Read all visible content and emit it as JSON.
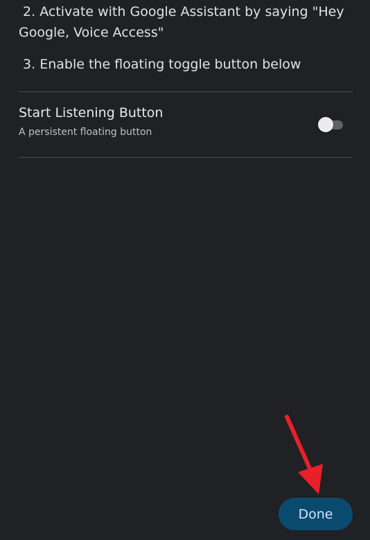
{
  "instructions": {
    "step2": " 2. Activate with Google Assistant by saying \"Hey Google, Voice Access\"",
    "step3": " 3. Enable the floating toggle button below"
  },
  "setting": {
    "title": "Start Listening Button",
    "subtitle": "A persistent floating button",
    "toggle_on": false
  },
  "actions": {
    "done_label": "Done"
  },
  "colors": {
    "background": "#1f2124",
    "button_bg": "#0b4a6f",
    "button_text": "#cfe6ff",
    "annotation_arrow": "#e8202a"
  },
  "icons": {
    "annotation": "red-arrow-icon"
  }
}
